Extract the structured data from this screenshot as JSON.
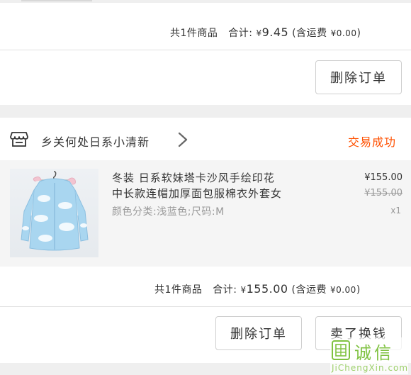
{
  "order1": {
    "summary": {
      "count_text": "共1件商品",
      "total_label": "合计:",
      "currency": "¥",
      "total": "9.45",
      "shipping_prefix": "(含运费",
      "shipping_value": "¥0.00",
      "shipping_suffix": ")"
    },
    "delete_button": "删除订单"
  },
  "order2": {
    "shop_name": "乡关何处日系小清新",
    "status": "交易成功",
    "product": {
      "title_line1": "冬装 日系软妹塔卡沙风手绘印花",
      "title_line2": "中长款连帽加厚面包服棉衣外套女",
      "sku": "颜色分类:浅蓝色;尺码:M",
      "price": "¥155.00",
      "original_price": "¥155.00",
      "quantity": "x1"
    },
    "summary": {
      "count_text": "共1件商品",
      "total_label": "合计:",
      "currency": "¥",
      "total": "155.00",
      "shipping_prefix": "(含运费",
      "shipping_value": "¥0.00",
      "shipping_suffix": ")"
    },
    "delete_button": "删除订单",
    "resell_button": "卖了换钱"
  },
  "watermark": {
    "chars": "诚信",
    "site": "JiChengXin.com"
  },
  "colors": {
    "status": "#ff5000",
    "background_band": "#efefef",
    "watermark": "#7fc241"
  },
  "icons": {
    "shop": "shop-icon",
    "chevron": "chevron-right-icon"
  }
}
